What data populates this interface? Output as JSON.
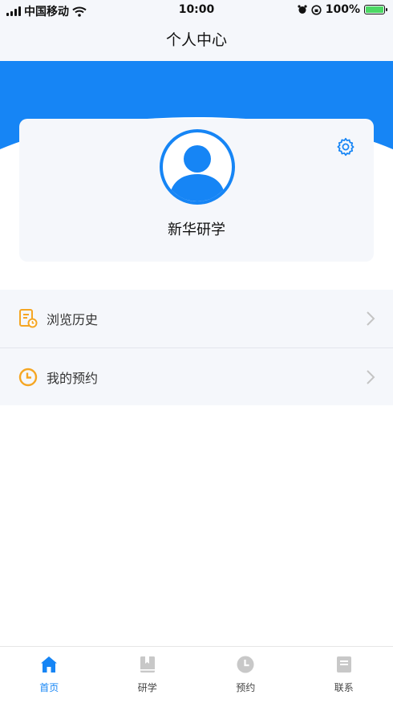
{
  "status_bar": {
    "carrier": "中国移动",
    "time": "10:00",
    "battery": "100%",
    "battery_level": 1.0
  },
  "header": {
    "title": "个人中心"
  },
  "profile": {
    "username": "新华研学",
    "avatar_icon": "user-avatar-icon",
    "settings_icon": "gear-icon"
  },
  "menu": {
    "items": [
      {
        "label": "浏览历史",
        "icon": "history-document-icon"
      },
      {
        "label": "我的预约",
        "icon": "clock-icon"
      }
    ]
  },
  "tab_bar": {
    "items": [
      {
        "label": "首页",
        "icon": "home-icon",
        "active": true
      },
      {
        "label": "研学",
        "icon": "book-icon",
        "active": false
      },
      {
        "label": "预约",
        "icon": "clock-icon",
        "active": false
      },
      {
        "label": "联系",
        "icon": "contact-icon",
        "active": false
      }
    ]
  },
  "colors": {
    "accent": "#1685f5",
    "icon_orange": "#f5a623",
    "inactive_icon": "#c8c8c8",
    "panel_background": "#f5f7fb"
  }
}
